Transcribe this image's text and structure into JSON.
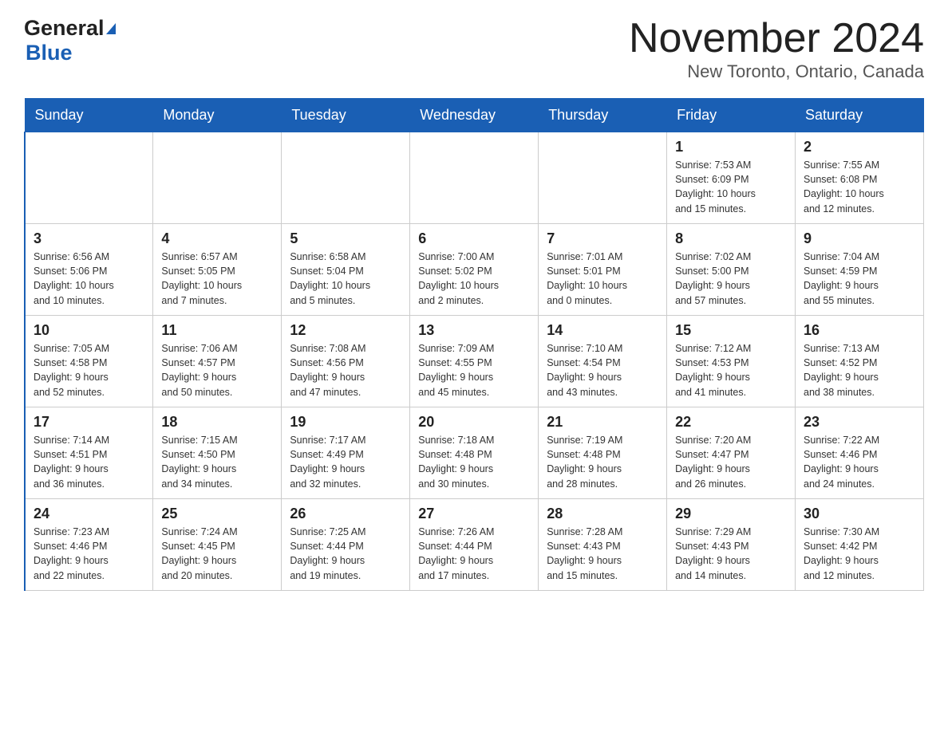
{
  "logo": {
    "line1": "General",
    "arrow": "▶",
    "line2": "Blue"
  },
  "title": "November 2024",
  "subtitle": "New Toronto, Ontario, Canada",
  "days": [
    "Sunday",
    "Monday",
    "Tuesday",
    "Wednesday",
    "Thursday",
    "Friday",
    "Saturday"
  ],
  "weeks": [
    [
      {
        "day": "",
        "info": ""
      },
      {
        "day": "",
        "info": ""
      },
      {
        "day": "",
        "info": ""
      },
      {
        "day": "",
        "info": ""
      },
      {
        "day": "",
        "info": ""
      },
      {
        "day": "1",
        "info": "Sunrise: 7:53 AM\nSunset: 6:09 PM\nDaylight: 10 hours\nand 15 minutes."
      },
      {
        "day": "2",
        "info": "Sunrise: 7:55 AM\nSunset: 6:08 PM\nDaylight: 10 hours\nand 12 minutes."
      }
    ],
    [
      {
        "day": "3",
        "info": "Sunrise: 6:56 AM\nSunset: 5:06 PM\nDaylight: 10 hours\nand 10 minutes."
      },
      {
        "day": "4",
        "info": "Sunrise: 6:57 AM\nSunset: 5:05 PM\nDaylight: 10 hours\nand 7 minutes."
      },
      {
        "day": "5",
        "info": "Sunrise: 6:58 AM\nSunset: 5:04 PM\nDaylight: 10 hours\nand 5 minutes."
      },
      {
        "day": "6",
        "info": "Sunrise: 7:00 AM\nSunset: 5:02 PM\nDaylight: 10 hours\nand 2 minutes."
      },
      {
        "day": "7",
        "info": "Sunrise: 7:01 AM\nSunset: 5:01 PM\nDaylight: 10 hours\nand 0 minutes."
      },
      {
        "day": "8",
        "info": "Sunrise: 7:02 AM\nSunset: 5:00 PM\nDaylight: 9 hours\nand 57 minutes."
      },
      {
        "day": "9",
        "info": "Sunrise: 7:04 AM\nSunset: 4:59 PM\nDaylight: 9 hours\nand 55 minutes."
      }
    ],
    [
      {
        "day": "10",
        "info": "Sunrise: 7:05 AM\nSunset: 4:58 PM\nDaylight: 9 hours\nand 52 minutes."
      },
      {
        "day": "11",
        "info": "Sunrise: 7:06 AM\nSunset: 4:57 PM\nDaylight: 9 hours\nand 50 minutes."
      },
      {
        "day": "12",
        "info": "Sunrise: 7:08 AM\nSunset: 4:56 PM\nDaylight: 9 hours\nand 47 minutes."
      },
      {
        "day": "13",
        "info": "Sunrise: 7:09 AM\nSunset: 4:55 PM\nDaylight: 9 hours\nand 45 minutes."
      },
      {
        "day": "14",
        "info": "Sunrise: 7:10 AM\nSunset: 4:54 PM\nDaylight: 9 hours\nand 43 minutes."
      },
      {
        "day": "15",
        "info": "Sunrise: 7:12 AM\nSunset: 4:53 PM\nDaylight: 9 hours\nand 41 minutes."
      },
      {
        "day": "16",
        "info": "Sunrise: 7:13 AM\nSunset: 4:52 PM\nDaylight: 9 hours\nand 38 minutes."
      }
    ],
    [
      {
        "day": "17",
        "info": "Sunrise: 7:14 AM\nSunset: 4:51 PM\nDaylight: 9 hours\nand 36 minutes."
      },
      {
        "day": "18",
        "info": "Sunrise: 7:15 AM\nSunset: 4:50 PM\nDaylight: 9 hours\nand 34 minutes."
      },
      {
        "day": "19",
        "info": "Sunrise: 7:17 AM\nSunset: 4:49 PM\nDaylight: 9 hours\nand 32 minutes."
      },
      {
        "day": "20",
        "info": "Sunrise: 7:18 AM\nSunset: 4:48 PM\nDaylight: 9 hours\nand 30 minutes."
      },
      {
        "day": "21",
        "info": "Sunrise: 7:19 AM\nSunset: 4:48 PM\nDaylight: 9 hours\nand 28 minutes."
      },
      {
        "day": "22",
        "info": "Sunrise: 7:20 AM\nSunset: 4:47 PM\nDaylight: 9 hours\nand 26 minutes."
      },
      {
        "day": "23",
        "info": "Sunrise: 7:22 AM\nSunset: 4:46 PM\nDaylight: 9 hours\nand 24 minutes."
      }
    ],
    [
      {
        "day": "24",
        "info": "Sunrise: 7:23 AM\nSunset: 4:46 PM\nDaylight: 9 hours\nand 22 minutes."
      },
      {
        "day": "25",
        "info": "Sunrise: 7:24 AM\nSunset: 4:45 PM\nDaylight: 9 hours\nand 20 minutes."
      },
      {
        "day": "26",
        "info": "Sunrise: 7:25 AM\nSunset: 4:44 PM\nDaylight: 9 hours\nand 19 minutes."
      },
      {
        "day": "27",
        "info": "Sunrise: 7:26 AM\nSunset: 4:44 PM\nDaylight: 9 hours\nand 17 minutes."
      },
      {
        "day": "28",
        "info": "Sunrise: 7:28 AM\nSunset: 4:43 PM\nDaylight: 9 hours\nand 15 minutes."
      },
      {
        "day": "29",
        "info": "Sunrise: 7:29 AM\nSunset: 4:43 PM\nDaylight: 9 hours\nand 14 minutes."
      },
      {
        "day": "30",
        "info": "Sunrise: 7:30 AM\nSunset: 4:42 PM\nDaylight: 9 hours\nand 12 minutes."
      }
    ]
  ]
}
